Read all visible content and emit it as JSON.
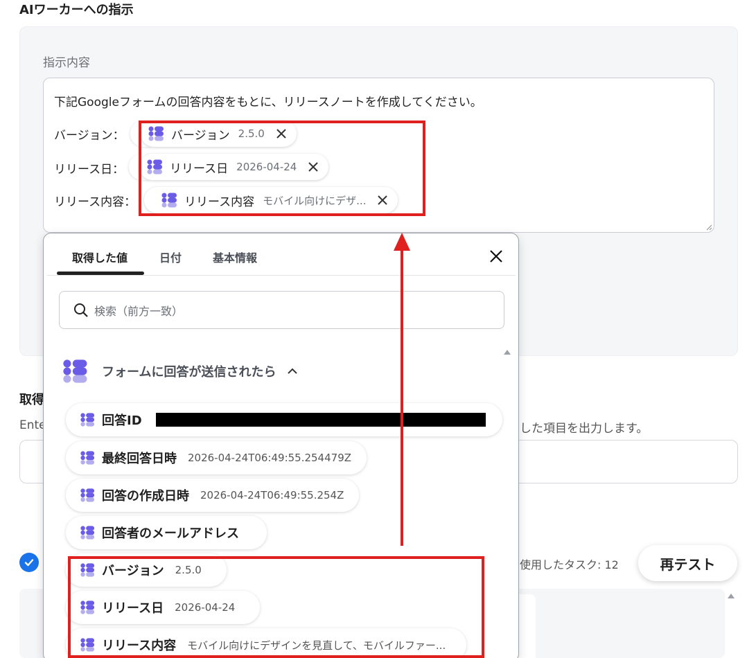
{
  "section_title": "AIワーカーへの指示",
  "instruction": {
    "label": "指示内容",
    "first_line": "下記Googleフォームの回答内容をもとに、リリースノートを作成してください。",
    "rows": [
      {
        "prefix": "バージョン：",
        "pill_name": "バージョン",
        "pill_value": "2.5.0"
      },
      {
        "prefix": "リリース日：",
        "pill_name": "リリース日",
        "pill_value": "2026-04-24"
      },
      {
        "prefix": "リリース内容：",
        "pill_name": "リリース内容",
        "pill_value": "モバイル向けにデザ..."
      }
    ]
  },
  "background": {
    "heading_fragment": "取得",
    "description_start": "Ente",
    "description_end": "した項目を出力します。",
    "tasks_used": "使用したタスク: 12",
    "retest_label": "再テスト"
  },
  "dropdown": {
    "tabs": [
      "取得した値",
      "日付",
      "基本情報"
    ],
    "active_tab": 0,
    "search_placeholder": "検索（前方一致）",
    "group_title": "フォームに回答が送信されたら",
    "items": [
      {
        "name": "回答ID",
        "value": "",
        "redacted": true
      },
      {
        "name": "最終回答日時",
        "value": "2026-04-24T06:49:55.254479Z"
      },
      {
        "name": "回答の作成日時",
        "value": "2026-04-24T06:49:55.254Z"
      },
      {
        "name": "回答者のメールアドレス",
        "value": ""
      },
      {
        "name": "バージョン",
        "value": "2.5.0"
      },
      {
        "name": "リリース日",
        "value": "2026-04-24"
      },
      {
        "name": "リリース内容",
        "value": "モバイル向けにデザインを見直して、モバイルファー..."
      }
    ]
  },
  "colors": {
    "accent_blue": "#1a73e8",
    "highlight_red": "#e0201f",
    "icon_purple": "#6b5ce7",
    "icon_lavender": "#b3adf0"
  }
}
